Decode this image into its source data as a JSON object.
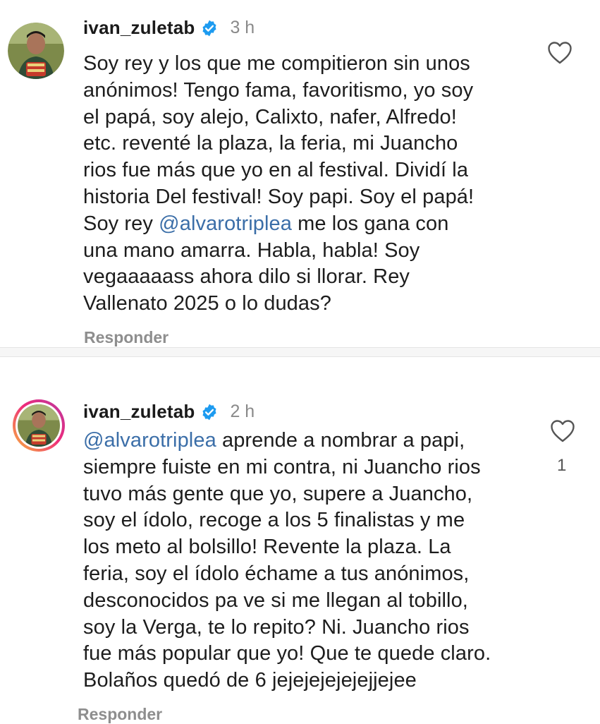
{
  "comments": [
    {
      "username": "ivan_zuletab",
      "time": "3 h",
      "text_part1": "Soy rey y los que me compitieron sin unos\nanónimos! Tengo fama, favoritismo, yo soy\nel papá, soy alejo, Calixto, nafer, Alfredo!\netc. reventé la plaza, la feria, mi Juancho\nrios fue más que yo en al festival. Dividí la\nhistoria Del festival! Soy papi. Soy el papá!\nSoy rey ",
      "mention": "@alvarotriplea",
      "text_part2": " me los gana con\nuna mano amarra. Habla, habla! Soy\nvegaaaaass ahora dilo si llorar. Rey\nVallenato 2025 o lo dudas?",
      "reply_label": "Responder",
      "like_count": ""
    },
    {
      "username": "ivan_zuletab",
      "time": "2 h",
      "mention": "@alvarotriplea",
      "text_part2": " aprende a nombrar a papi,\nsiempre fuiste en mi contra, ni Juancho rios\ntuvo más gente que yo, supere a Juancho,\nsoy el ídolo, recoge a los 5 finalistas y me\nlos meto al bolsillo! Revente la plaza. La\nferia, soy el ídolo échame a tus anónimos,\ndesconocidos  pa ve si me llegan al tobillo,\nsoy la Verga, te lo repito? Ni. Juancho rios\nfue más popular que yo! Que te quede claro.\nBolaños quedó de 6 jejejejejejejjejee",
      "reply_label": "Responder",
      "like_count": "1"
    }
  ],
  "icons": {
    "verified": "verified-badge-icon",
    "like": "heart-outline-icon"
  },
  "colors": {
    "mention": "#3b6ea8",
    "verified": "#1d9bf0",
    "muted": "#8e8e8e"
  }
}
